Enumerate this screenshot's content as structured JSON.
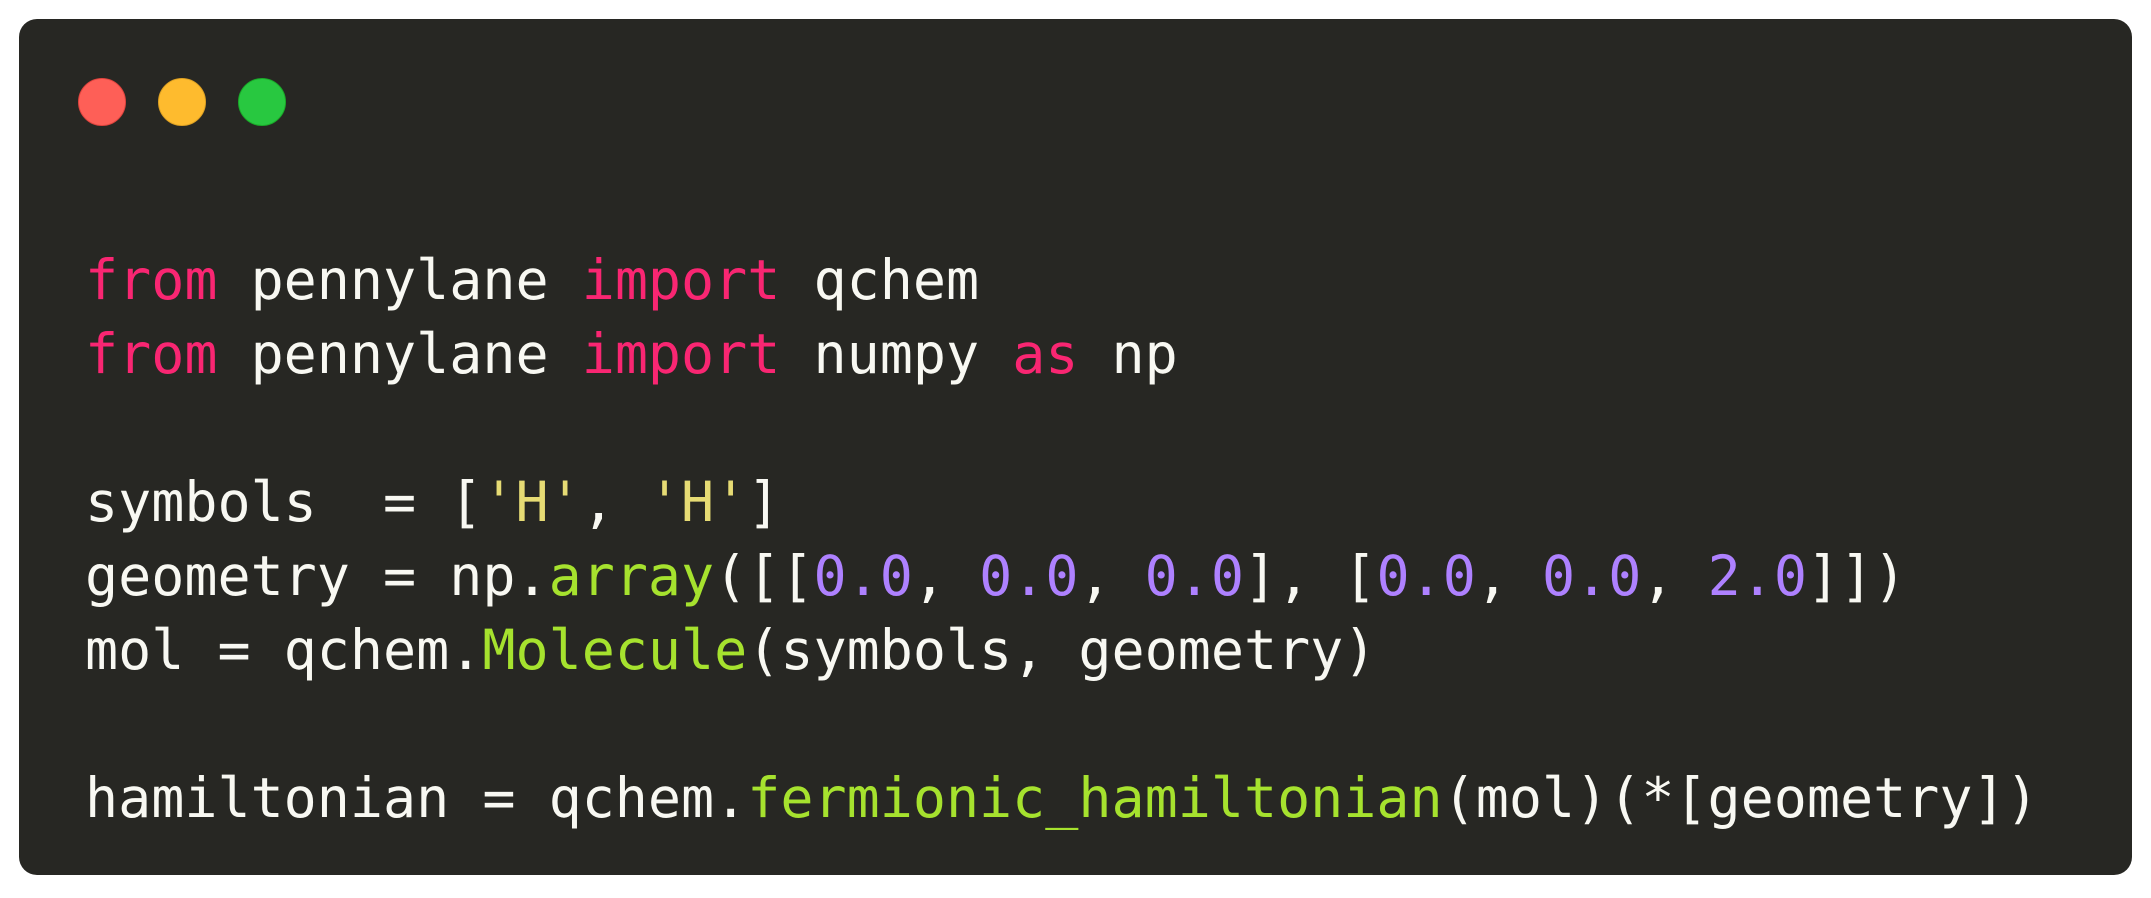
{
  "window": {
    "controls": {
      "close_color": "#fe5f57",
      "minimize_color": "#febb2e",
      "maximize_color": "#28c840"
    }
  },
  "code": {
    "lines": [
      [
        {
          "t": "from",
          "c": "kw"
        },
        {
          "t": " pennylane ",
          "c": "plain"
        },
        {
          "t": "import",
          "c": "kw"
        },
        {
          "t": " qchem",
          "c": "plain"
        }
      ],
      [
        {
          "t": "from",
          "c": "kw"
        },
        {
          "t": " pennylane ",
          "c": "plain"
        },
        {
          "t": "import",
          "c": "kw"
        },
        {
          "t": " numpy ",
          "c": "plain"
        },
        {
          "t": "as",
          "c": "kw"
        },
        {
          "t": " np",
          "c": "plain"
        }
      ],
      [],
      [
        {
          "t": "symbols  = [",
          "c": "plain"
        },
        {
          "t": "'H'",
          "c": "str"
        },
        {
          "t": ", ",
          "c": "plain"
        },
        {
          "t": "'H'",
          "c": "str"
        },
        {
          "t": "]",
          "c": "plain"
        }
      ],
      [
        {
          "t": "geometry = np.",
          "c": "plain"
        },
        {
          "t": "array",
          "c": "fn"
        },
        {
          "t": "([[",
          "c": "plain"
        },
        {
          "t": "0.0",
          "c": "num"
        },
        {
          "t": ", ",
          "c": "plain"
        },
        {
          "t": "0.0",
          "c": "num"
        },
        {
          "t": ", ",
          "c": "plain"
        },
        {
          "t": "0.0",
          "c": "num"
        },
        {
          "t": "], [",
          "c": "plain"
        },
        {
          "t": "0.0",
          "c": "num"
        },
        {
          "t": ", ",
          "c": "plain"
        },
        {
          "t": "0.0",
          "c": "num"
        },
        {
          "t": ", ",
          "c": "plain"
        },
        {
          "t": "2.0",
          "c": "num"
        },
        {
          "t": "]])",
          "c": "plain"
        }
      ],
      [
        {
          "t": "mol = qchem.",
          "c": "plain"
        },
        {
          "t": "Molecule",
          "c": "fn"
        },
        {
          "t": "(symbols, geometry)",
          "c": "plain"
        }
      ],
      [],
      [
        {
          "t": "hamiltonian = qchem.",
          "c": "plain"
        },
        {
          "t": "fermionic_hamiltonian",
          "c": "fn"
        },
        {
          "t": "(mol)(*[geometry])",
          "c": "plain"
        }
      ]
    ]
  }
}
